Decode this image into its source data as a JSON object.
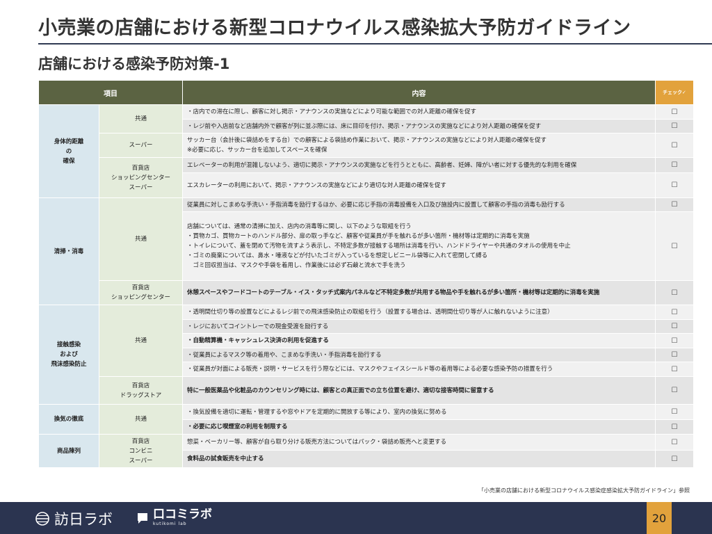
{
  "title": "小売業の店舗における新型コロナウイルス感染拡大予防ガイドライン",
  "subtitle": "店舗における感染予防対策-1",
  "table": {
    "headers": {
      "item": "項目",
      "content": "内容",
      "check": "チェック✓"
    },
    "rows": [
      {
        "cat": "身体的距離\nの\n確保",
        "catSpan": 5,
        "sub": "共通",
        "subSpan": 2,
        "content": "・店内での滞在に際し、顧客に対し掲示・アナウンスの実施などにより可能な範囲での対人距離の確保を促す",
        "check": "☐",
        "bold": false,
        "h": 21
      },
      {
        "content": "・レジ前や入店前など店舗内外で顧客が列に並ぶ際には、床に目印を付け、掲示・アナウンスの実施などにより対人距離の確保を促す",
        "check": "☐",
        "bold": false,
        "h": 20
      },
      {
        "sub": "スーパー",
        "subSpan": 1,
        "content": "サッカー台（会計後に袋詰めをする台）での顧客による袋詰め作業において、掲示・アナウンスの実施などにより対人距離の確保を促す\n※必要に応じ、サッカー台を追加してスペースを確保",
        "check": "☐",
        "bold": false,
        "h": 35
      },
      {
        "sub": "百貨店\nショッピングセンター\nスーパー",
        "subSpan": 2,
        "content": "エレベーターの利用が混雑しないよう、適切に掲示・アナウンスの実施などを行うとともに、高齢者、妊婦、障がい者に対する優先的な利用を確保",
        "check": "☐",
        "bold": false,
        "h": 22
      },
      {
        "content": "エスカレーターの利用において、掲示・アナウンスの実施などにより適切な対人距離の確保を促す",
        "check": "☐",
        "bold": false,
        "h": 36
      },
      {
        "cat": "清掃・消毒",
        "catSpan": 3,
        "sub": "共通",
        "subSpan": 2,
        "content": "従業員に対しこまめな手洗い・手指消毒を励行するほか、必要に応じ手指の消毒設備を入口及び施設内に設置して顧客の手指の消毒も励行する",
        "check": "☐",
        "bold": false,
        "h": 20
      },
      {
        "content": "店舗については、通常の清掃に加え、店内の消毒等に関し、以下のような取組を行う\n・買物カゴ、買物カートのハンドル部分、扉の取っ手など、顧客や従業員が手を触れるが多い箇所・機材等は定期的に消毒を実施\n・トイレについて、蓋を閉めて汚物を流すよう表示し、不特定多数が接触する場所は消毒を行い、ハンドドライヤーや共通のタオルの使用を中止\n・ゴミの廃棄については、鼻水・唾液などが付いたゴミが入っているを想定しビニール袋等に入れて密閉して縛る\n　ゴミ回収担当は、マスクや手袋を着用し、作業後には必ず石鹸と流水で手を洗う",
        "check": "☐",
        "bold": false,
        "h": 99
      },
      {
        "sub": "百貨店\nショッピングセンター",
        "subSpan": 1,
        "content": "休憩スペースやフードコートのテーブル・イス・タッチ式案内パネルなど不特定多数が共用する物品や手を触れるが多い箇所・機材等は定期的に消毒を実施",
        "check": "☐",
        "bold": true,
        "h": 35
      },
      {
        "cat": "接触感染\nおよび\n飛沫感染防止",
        "catSpan": 6,
        "sub": "共通",
        "subSpan": 5,
        "content": "・透明間仕切り等の設置などによるレジ前での飛沫感染防止の取組を行う（設置する場合は、透明間仕切り等が人に触れないように注意）",
        "check": "☐",
        "bold": false,
        "h": 21
      },
      {
        "content": "・レジにおいてコイントレーでの現金受渡を励行する",
        "check": "☐",
        "bold": false,
        "h": 20
      },
      {
        "content": "・自動精算機・キャッシュレス決済の利用を促進する",
        "check": "☐",
        "bold": true,
        "h": 21
      },
      {
        "content": "・従業員によるマスク等の着用や、こまめな手洗い・手指消毒を励行する",
        "check": "☐",
        "bold": false,
        "h": 20
      },
      {
        "content": "・従業員が対面による販売・説明・サービスを行う際などには、マスクやフェイスシールド等の着用等による必要な感染予防の措置を行う",
        "check": "☐",
        "bold": false,
        "h": 21
      },
      {
        "sub": "百貨店\nドラッグストア",
        "subSpan": 1,
        "content": "特に一般医薬品や化粧品のカウンセリング時には、顧客との真正面での立ち位置を避け、適切な接客時間に留意する",
        "check": "☐",
        "bold": true,
        "h": 40
      },
      {
        "cat": "換気の徹底",
        "catSpan": 2,
        "sub": "共通",
        "subSpan": 2,
        "content": "・換気設備を適切に運転・管理するや窓やドアを定期的に開放する等により、室内の換気に努める",
        "check": "☐",
        "bold": false,
        "h": 22
      },
      {
        "content": "・必要に応じ喫煙室の利用を制限する",
        "check": "☐",
        "bold": true,
        "h": 21
      },
      {
        "cat": "商品陳列",
        "catSpan": 2,
        "sub": "百貨店\nコンビニ\nスーパー",
        "subSpan": 2,
        "content": "惣菜・ベーカリー等、顧客が自ら取り分ける販売方法についてはパック・袋詰め販売へと変更する",
        "check": "☐",
        "bold": false,
        "h": 23
      },
      {
        "content": "食料品の試食販売を中止する",
        "check": "☐",
        "bold": true,
        "h": 25
      }
    ]
  },
  "source": "「小売業の店舗における新型コロナウイルス感染症感染拡大予防ガイドライン」参照",
  "footer": {
    "logo1": "訪日ラボ",
    "logo2_main": "口コミラボ",
    "logo2_sub": "kutikomi lab",
    "page": "20"
  }
}
